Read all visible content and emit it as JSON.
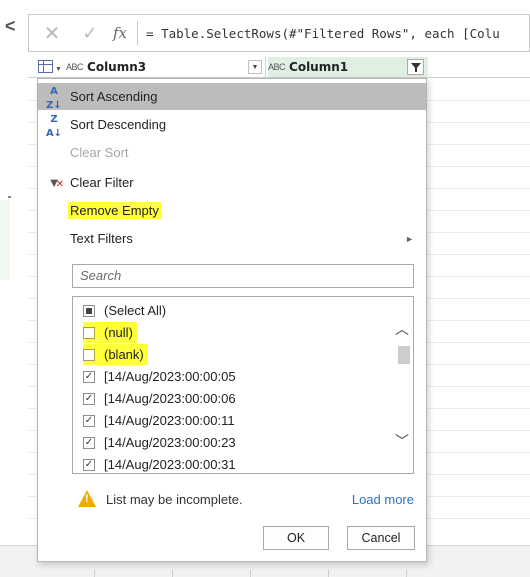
{
  "window": {
    "collapse_arrow": "<"
  },
  "formula_bar": {
    "cancel_icon": "cancel-x",
    "commit_icon": "checkmark",
    "fx_label": "fx",
    "formula": "= Table.SelectRows(#\"Filtered Rows\", each [Colu"
  },
  "grid": {
    "columns": [
      {
        "type_label": "ABC",
        "name": "Column3"
      },
      {
        "type_label": "ABC",
        "name": "Column1"
      }
    ]
  },
  "menu": {
    "sort_ascending": "Sort Ascending",
    "sort_descending": "Sort Descending",
    "clear_sort": "Clear Sort",
    "clear_filter": "Clear Filter",
    "remove_empty": "Remove Empty",
    "text_filters": "Text Filters",
    "search_placeholder": "Search",
    "list_items": [
      {
        "label": "(Select All)",
        "state": "partial"
      },
      {
        "label": "(null)",
        "state": "unchecked"
      },
      {
        "label": "(blank)",
        "state": "unchecked"
      },
      {
        "label": "[14/Aug/2023:00:00:05",
        "state": "checked"
      },
      {
        "label": "[14/Aug/2023:00:00:06",
        "state": "checked"
      },
      {
        "label": "[14/Aug/2023:00:00:11",
        "state": "checked"
      },
      {
        "label": "[14/Aug/2023:00:00:23",
        "state": "checked"
      },
      {
        "label": "[14/Aug/2023:00:00:31",
        "state": "checked"
      }
    ],
    "warning_text": "List may be incomplete.",
    "load_more": "Load more",
    "ok": "OK",
    "cancel": "Cancel"
  },
  "colors": {
    "highlight": "#ffff3a",
    "active_item": "#bcbcbc",
    "link": "#2a72c5",
    "selected_column": "#dff0e2",
    "warning": "#f2a900"
  }
}
